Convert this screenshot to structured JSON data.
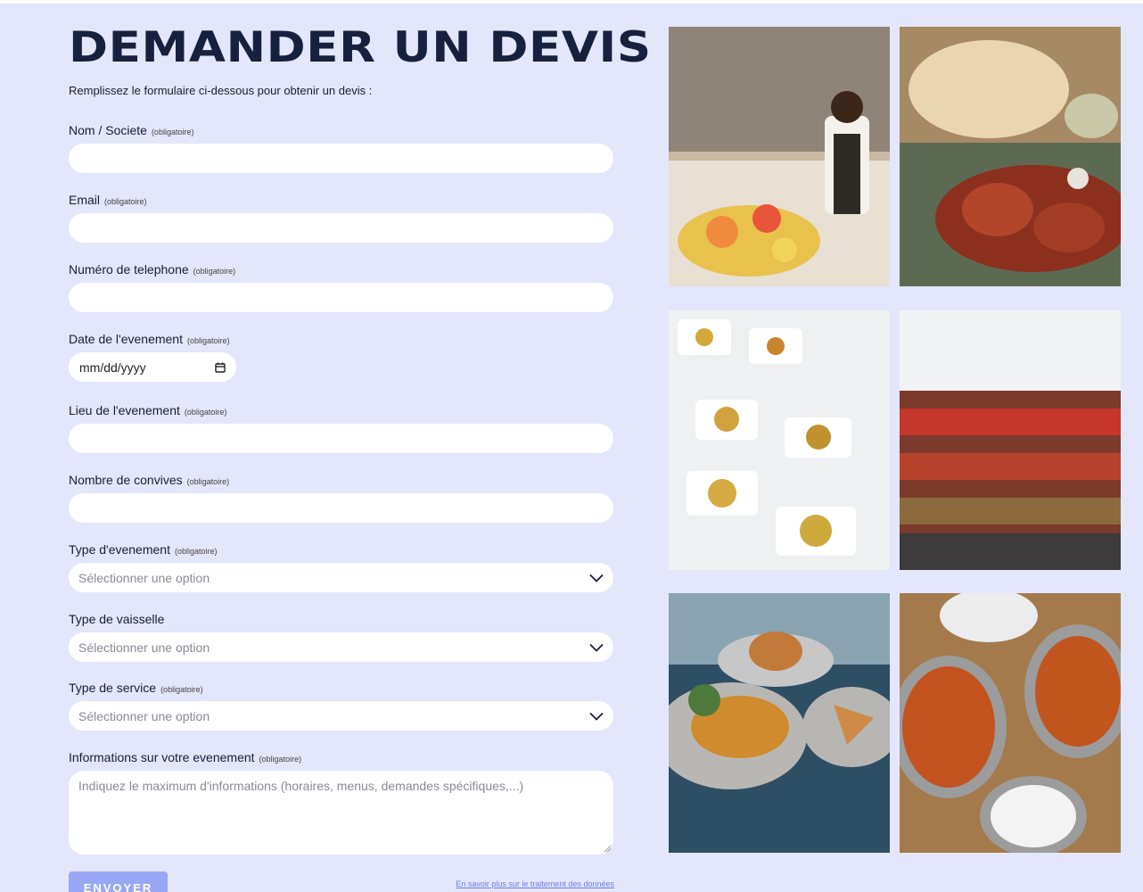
{
  "page": {
    "title": "DEMANDER UN DEVIS",
    "subtitle": "Remplissez le formulaire ci-dessous pour obtenir un devis :"
  },
  "form": {
    "required_tag": "(obligatoire)",
    "fields": {
      "name": {
        "label": "Nom / Societe",
        "value": ""
      },
      "email": {
        "label": "Email",
        "value": ""
      },
      "phone": {
        "label": "Numéro de telephone",
        "value": ""
      },
      "date": {
        "label": "Date de l'evenement",
        "placeholder": "mm/dd/yyyy"
      },
      "location": {
        "label": "Lieu de l'evenement",
        "value": ""
      },
      "guests": {
        "label": "Nombre de convives",
        "value": ""
      },
      "event_type": {
        "label": "Type d'evenement",
        "selected": "Sélectionner une option"
      },
      "tableware": {
        "label": "Type de vaisselle",
        "selected": "Sélectionner une option"
      },
      "service_type": {
        "label": "Type de service",
        "selected": "Sélectionner une option"
      },
      "event_info": {
        "label": "Informations sur votre evenement",
        "placeholder": "Indiquez le maximum d'informations (horaires, menus, demandes spécifiques,...)"
      }
    },
    "submit_label": "ENVOYER",
    "privacy_link": "En savoir plus sur le traitement des données"
  },
  "icons": {
    "calendar": "calendar-icon",
    "dropdown": "chevron-down-icon",
    "resize": "resize-grip-icon"
  },
  "colors": {
    "background": "#e4e6fb",
    "title": "#18203f",
    "submit_button": "#98a8f5",
    "link": "#6b7de8"
  }
}
